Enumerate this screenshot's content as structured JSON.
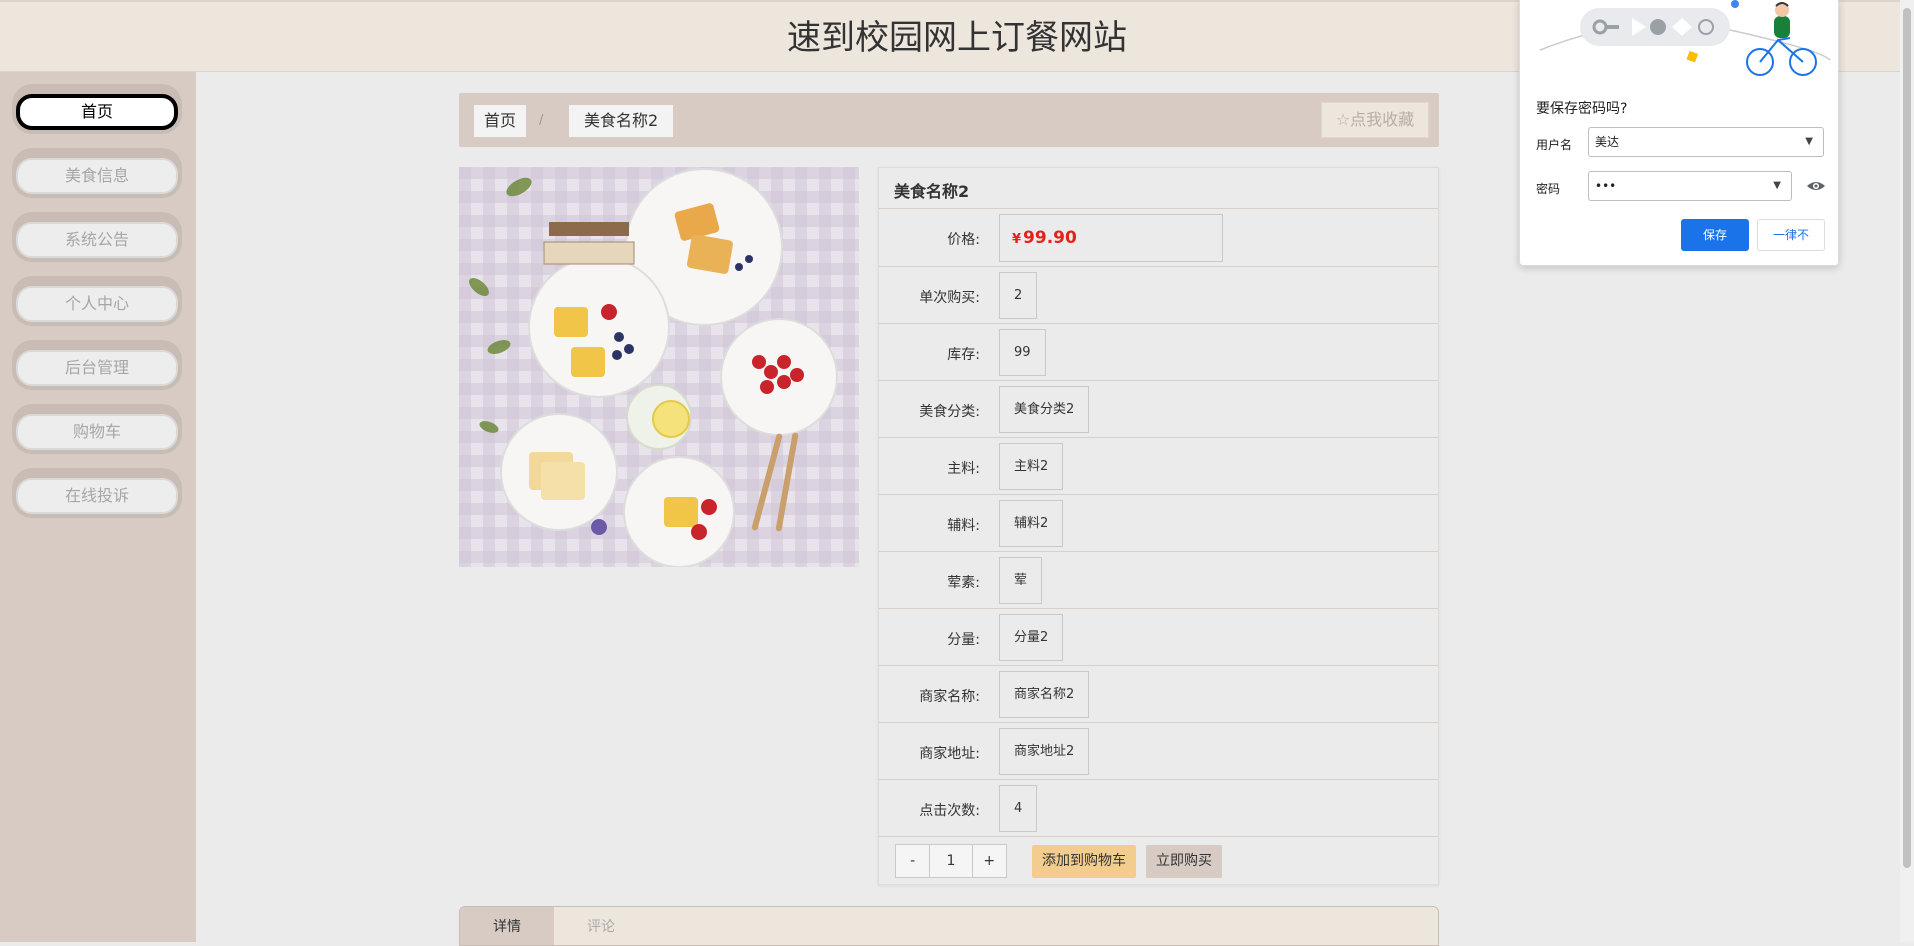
{
  "header": {
    "title": "速到校园网上订餐网站"
  },
  "sidebar": {
    "items": [
      {
        "label": "首页",
        "active": true
      },
      {
        "label": "美食信息"
      },
      {
        "label": "系统公告"
      },
      {
        "label": "个人中心"
      },
      {
        "label": "后台管理"
      },
      {
        "label": "购物车"
      },
      {
        "label": "在线投诉"
      }
    ]
  },
  "breadcrumb": {
    "home": "首页",
    "separator": "/",
    "current": "美食名称2"
  },
  "favorite": {
    "label": "点我收藏",
    "icon": "star-outline-icon"
  },
  "product": {
    "name": "美食名称2",
    "currency": "¥",
    "price": "99.90",
    "fields": [
      {
        "label": "价格:",
        "value": ""
      },
      {
        "label": "单次购买:",
        "value": "2"
      },
      {
        "label": "库存:",
        "value": "99"
      },
      {
        "label": "美食分类:",
        "value": "美食分类2"
      },
      {
        "label": "主料:",
        "value": "主料2"
      },
      {
        "label": "辅料:",
        "value": "辅料2"
      },
      {
        "label": "荤素:",
        "value": "荤"
      },
      {
        "label": "分量:",
        "value": "分量2"
      },
      {
        "label": "商家名称:",
        "value": "商家名称2"
      },
      {
        "label": "商家地址:",
        "value": "商家地址2"
      },
      {
        "label": "点击次数:",
        "value": "4"
      }
    ]
  },
  "quantity": {
    "minus": "-",
    "value": "1",
    "plus": "+"
  },
  "actions": {
    "add_to_cart": "添加到购物车",
    "buy_now": "立即购买"
  },
  "tabs": [
    {
      "label": "详情",
      "active": true
    },
    {
      "label": "评论"
    }
  ],
  "password_dialog": {
    "title": "要保存密码吗?",
    "username_label": "用户名",
    "username_value": "美达",
    "password_label": "密码",
    "password_value": "•••",
    "save": "保存",
    "never": "一律不"
  },
  "colors": {
    "header_bg": "#ede6dd",
    "sidebar_bg": "#d8cbc3",
    "price": "#e2231a",
    "cart_button": "#f2cd8d",
    "save_button": "#1a73e8"
  }
}
